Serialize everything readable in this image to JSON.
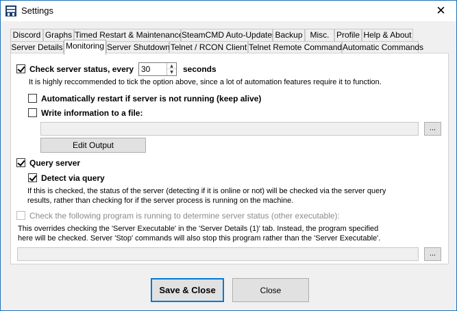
{
  "window": {
    "title": "Settings",
    "close_glyph": "✕"
  },
  "tabs_row1": [
    "Discord",
    "Graphs",
    "Timed Restart & Maintenance",
    "SteamCMD Auto-Updates",
    "Backup",
    "Misc.",
    "Profile",
    "Help & About"
  ],
  "tabs_row2": [
    "Server Details",
    "Monitoring",
    "Server Shutdown",
    "Telnet / RCON Client",
    "Telnet Remote Commands",
    "Automatic Commands"
  ],
  "active_tab": "Monitoring",
  "monitoring": {
    "check_status": {
      "label": "Check server status, every",
      "checked": true,
      "interval": "30",
      "unit": "seconds",
      "hint": "It is highly reccommended to tick the option above, since a lot of automation features require it to function."
    },
    "auto_restart": {
      "label": "Automatically restart if server is not running (keep alive)",
      "checked": false
    },
    "write_info": {
      "label": "Write information to a file:",
      "checked": false,
      "path": "",
      "browse_label": "..."
    },
    "edit_output_label": "Edit Output",
    "query_server": {
      "label": "Query server",
      "checked": true
    },
    "detect_via_query": {
      "label": "Detect via query",
      "checked": true,
      "hint_line1": "If this is checked, the status of the server (detecting if it is online or not) will be checked via the server query",
      "hint_line2": "results, rather than checking for if the server process is running on the machine."
    },
    "other_program": {
      "label": "Check the following program is running to determine server status (other executable):",
      "checked": false,
      "enabled": false,
      "hint_line1": "This overrides checking the 'Server Executable' in the 'Server Details (1)' tab. Instead, the program specified",
      "hint_line2": "here will be checked. Server 'Stop' commands will also stop this program rather than the 'Server Executable'.",
      "path": "",
      "browse_label": "..."
    }
  },
  "footer": {
    "save_label": "Save & Close",
    "close_label": "Close"
  },
  "icons": {
    "app": "server-rack-icon",
    "spin_up": "▲",
    "spin_down": "▼"
  }
}
